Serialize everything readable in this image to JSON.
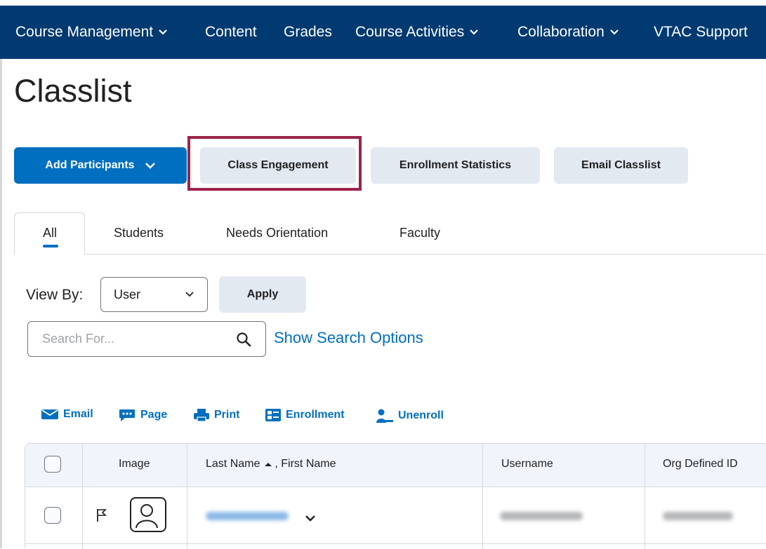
{
  "nav": {
    "items": [
      {
        "label": "Course Management",
        "has_dropdown": true
      },
      {
        "label": "Content",
        "has_dropdown": false
      },
      {
        "label": "Grades",
        "has_dropdown": false
      },
      {
        "label": "Course Activities",
        "has_dropdown": true
      },
      {
        "label": "Collaboration",
        "has_dropdown": true
      },
      {
        "label": "VTAC Support",
        "has_dropdown": false
      }
    ]
  },
  "page": {
    "title": "Classlist"
  },
  "buttons": {
    "add_participants": "Add Participants",
    "class_engagement": "Class Engagement",
    "enrollment_statistics": "Enrollment Statistics",
    "email_classlist": "Email Classlist"
  },
  "tabs": [
    {
      "label": "All",
      "selected": true
    },
    {
      "label": "Students",
      "selected": false
    },
    {
      "label": "Needs Orientation",
      "selected": false
    },
    {
      "label": "Faculty",
      "selected": false
    }
  ],
  "view_by": {
    "label": "View By:",
    "value": "User",
    "apply_label": "Apply"
  },
  "search": {
    "placeholder": "Search For...",
    "value": "",
    "options_link": "Show Search Options"
  },
  "actions": {
    "email": "Email",
    "page": "Page",
    "print": "Print",
    "enrollment": "Enrollment",
    "unenroll": "Unenroll"
  },
  "table": {
    "headers": {
      "image": "Image",
      "name": "Last Name",
      "name_sep": ", First Name",
      "username": "Username",
      "org_id": "Org Defined ID"
    }
  },
  "colors": {
    "nav_bg": "#003a70",
    "primary": "#006fbf",
    "secondary_bg": "#e3e9f1",
    "highlight": "#9c2348",
    "header_bg": "#f1f5fb"
  }
}
